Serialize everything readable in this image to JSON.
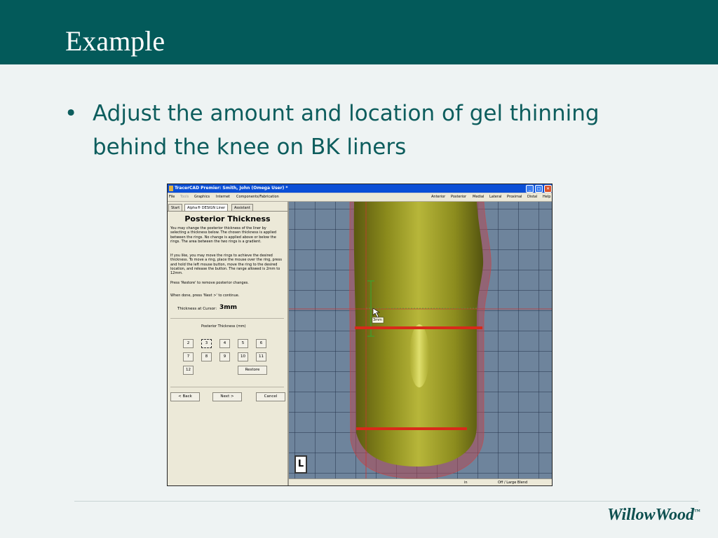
{
  "slide": {
    "title": "Example",
    "bullet_symbol": "•",
    "bullet_text": "Adjust the amount and location of gel thinning behind the knee on BK liners",
    "logo_text": "WillowWood",
    "logo_mark": "™"
  },
  "app": {
    "window_title": "TracerCAD Premier: Smith, John (Omega User) *",
    "window_buttons": [
      "_",
      "□",
      "✕"
    ],
    "menu": [
      "File",
      "Tools",
      "Graphics",
      "Internet",
      "Components/Fabrication"
    ],
    "view_menu": [
      "Anterior",
      "Posterior",
      "Medial",
      "Lateral",
      "Proximal",
      "Distal",
      "Help"
    ],
    "tabs": [
      "Start",
      "Alpha® DESIGN Liner",
      "Assistant"
    ],
    "heading": "Posterior Thickness",
    "para1": "You may change the posterior thickness of the liner by selecting a thickness below. The chosen thickness is applied between the rings. No change is applied above or below the rings. The area between the two rings is a gradient.",
    "para2": "If you like, you may move the rings to achieve the desired thickness. To move a ring, place the mouse over the ring, press and hold the left mouse button, move the ring to the desired location, and release the button. The range allowed is 2mm to 12mm.",
    "para3": "Press 'Restore' to remove posterior changes.",
    "para4": "When done, press 'Next >' to continue.",
    "thickness_label": "Thickness at Cursor:",
    "thickness_value": "3mm",
    "grid_label": "Posterior Thickness (mm)",
    "thickness_buttons": [
      "2",
      "3",
      "4",
      "5",
      "6",
      "7",
      "8",
      "9",
      "10",
      "11",
      "12"
    ],
    "selected_thickness": "3",
    "restore_label": "Restore",
    "back_label": "< Back",
    "next_label": "Next >",
    "cancel_label": "Cancel",
    "cursor_tooltip": "3mm",
    "view_badge": "L",
    "status_units": "in",
    "status_mode": "Off / Large Blend"
  }
}
